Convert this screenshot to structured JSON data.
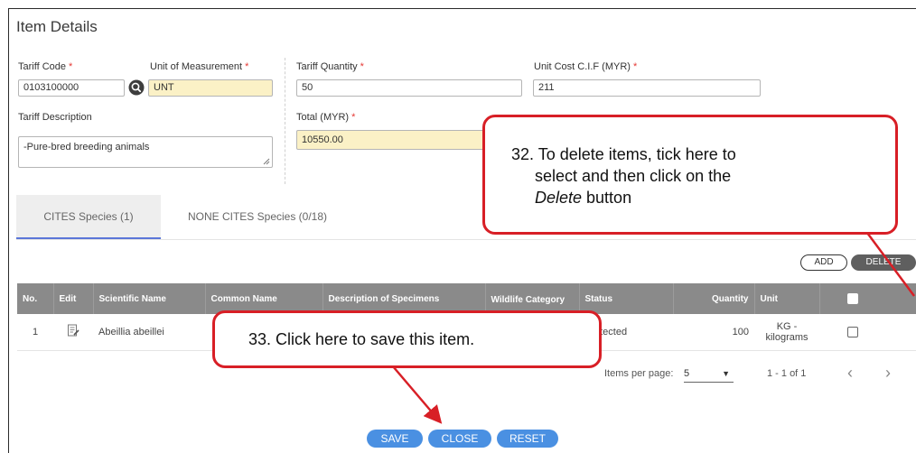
{
  "section": {
    "title": "Item Details"
  },
  "form": {
    "tariff_code_label": "Tariff Code",
    "tariff_code_value": "0103100000",
    "uom_label": "Unit of Measurement",
    "uom_value": "UNT",
    "tariff_qty_label": "Tariff Quantity",
    "tariff_qty_value": "50",
    "unit_cost_label": "Unit Cost C.I.F (MYR)",
    "unit_cost_value": "211",
    "tariff_desc_label": "Tariff Description",
    "tariff_desc_value": "-Pure-bred breeding animals",
    "total_label": "Total (MYR)",
    "total_value": "10550.00",
    "required_mark": "*"
  },
  "tabs": [
    {
      "label": "CITES Species (1)",
      "active": true
    },
    {
      "label": "NONE CITES Species (0/18)",
      "active": false
    }
  ],
  "table_actions": {
    "add_label": "ADD",
    "delete_label": "DELETE"
  },
  "table": {
    "headers": [
      "No.",
      "Edit",
      "Scientific Name",
      "Common Name",
      "Description of Specimens",
      "Wildlife Category",
      "Status",
      "Quantity",
      "Unit"
    ],
    "rows": [
      {
        "no": "1",
        "scientific_name": "Abeillia abeillei",
        "status": "Protected",
        "quantity": "100",
        "unit_line1": "KG -",
        "unit_line2": "kilograms"
      }
    ]
  },
  "pagination": {
    "items_per_page_label": "Items per page:",
    "items_per_page_value": "5",
    "range_text": "1 - 1 of 1"
  },
  "footer_buttons": {
    "save": "SAVE",
    "close": "CLOSE",
    "reset": "RESET"
  },
  "annotations": {
    "callout_32_line1": "32. To delete items, tick here to",
    "callout_32_line2": "select and then click on the",
    "callout_32_line3_em": "Delete",
    "callout_32_line3_rest": " button",
    "callout_33": "33. Click here to save this item."
  },
  "colors": {
    "accent_blue": "#4a90e2",
    "callout_red": "#d81f26",
    "required_red": "#e53935",
    "header_gray": "#8a8a8a",
    "highlight_yellow": "#fbf1c6"
  },
  "icons": {
    "search": "search-icon",
    "edit": "edit-document-icon",
    "prev": "chevron-left-icon",
    "next": "chevron-right-icon",
    "dropdown": "caret-down-icon"
  }
}
